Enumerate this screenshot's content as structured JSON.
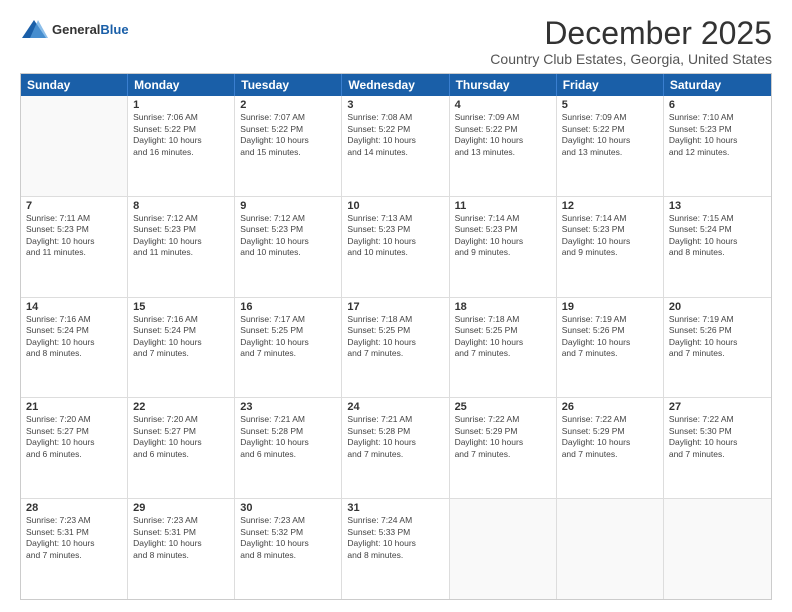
{
  "logo": {
    "general": "General",
    "blue": "Blue"
  },
  "title": "December 2025",
  "location": "Country Club Estates, Georgia, United States",
  "days_of_week": [
    "Sunday",
    "Monday",
    "Tuesday",
    "Wednesday",
    "Thursday",
    "Friday",
    "Saturday"
  ],
  "weeks": [
    [
      {
        "day": "",
        "info": ""
      },
      {
        "day": "1",
        "info": "Sunrise: 7:06 AM\nSunset: 5:22 PM\nDaylight: 10 hours\nand 16 minutes."
      },
      {
        "day": "2",
        "info": "Sunrise: 7:07 AM\nSunset: 5:22 PM\nDaylight: 10 hours\nand 15 minutes."
      },
      {
        "day": "3",
        "info": "Sunrise: 7:08 AM\nSunset: 5:22 PM\nDaylight: 10 hours\nand 14 minutes."
      },
      {
        "day": "4",
        "info": "Sunrise: 7:09 AM\nSunset: 5:22 PM\nDaylight: 10 hours\nand 13 minutes."
      },
      {
        "day": "5",
        "info": "Sunrise: 7:09 AM\nSunset: 5:22 PM\nDaylight: 10 hours\nand 13 minutes."
      },
      {
        "day": "6",
        "info": "Sunrise: 7:10 AM\nSunset: 5:23 PM\nDaylight: 10 hours\nand 12 minutes."
      }
    ],
    [
      {
        "day": "7",
        "info": "Sunrise: 7:11 AM\nSunset: 5:23 PM\nDaylight: 10 hours\nand 11 minutes."
      },
      {
        "day": "8",
        "info": "Sunrise: 7:12 AM\nSunset: 5:23 PM\nDaylight: 10 hours\nand 11 minutes."
      },
      {
        "day": "9",
        "info": "Sunrise: 7:12 AM\nSunset: 5:23 PM\nDaylight: 10 hours\nand 10 minutes."
      },
      {
        "day": "10",
        "info": "Sunrise: 7:13 AM\nSunset: 5:23 PM\nDaylight: 10 hours\nand 10 minutes."
      },
      {
        "day": "11",
        "info": "Sunrise: 7:14 AM\nSunset: 5:23 PM\nDaylight: 10 hours\nand 9 minutes."
      },
      {
        "day": "12",
        "info": "Sunrise: 7:14 AM\nSunset: 5:23 PM\nDaylight: 10 hours\nand 9 minutes."
      },
      {
        "day": "13",
        "info": "Sunrise: 7:15 AM\nSunset: 5:24 PM\nDaylight: 10 hours\nand 8 minutes."
      }
    ],
    [
      {
        "day": "14",
        "info": "Sunrise: 7:16 AM\nSunset: 5:24 PM\nDaylight: 10 hours\nand 8 minutes."
      },
      {
        "day": "15",
        "info": "Sunrise: 7:16 AM\nSunset: 5:24 PM\nDaylight: 10 hours\nand 7 minutes."
      },
      {
        "day": "16",
        "info": "Sunrise: 7:17 AM\nSunset: 5:25 PM\nDaylight: 10 hours\nand 7 minutes."
      },
      {
        "day": "17",
        "info": "Sunrise: 7:18 AM\nSunset: 5:25 PM\nDaylight: 10 hours\nand 7 minutes."
      },
      {
        "day": "18",
        "info": "Sunrise: 7:18 AM\nSunset: 5:25 PM\nDaylight: 10 hours\nand 7 minutes."
      },
      {
        "day": "19",
        "info": "Sunrise: 7:19 AM\nSunset: 5:26 PM\nDaylight: 10 hours\nand 7 minutes."
      },
      {
        "day": "20",
        "info": "Sunrise: 7:19 AM\nSunset: 5:26 PM\nDaylight: 10 hours\nand 7 minutes."
      }
    ],
    [
      {
        "day": "21",
        "info": "Sunrise: 7:20 AM\nSunset: 5:27 PM\nDaylight: 10 hours\nand 6 minutes."
      },
      {
        "day": "22",
        "info": "Sunrise: 7:20 AM\nSunset: 5:27 PM\nDaylight: 10 hours\nand 6 minutes."
      },
      {
        "day": "23",
        "info": "Sunrise: 7:21 AM\nSunset: 5:28 PM\nDaylight: 10 hours\nand 6 minutes."
      },
      {
        "day": "24",
        "info": "Sunrise: 7:21 AM\nSunset: 5:28 PM\nDaylight: 10 hours\nand 7 minutes."
      },
      {
        "day": "25",
        "info": "Sunrise: 7:22 AM\nSunset: 5:29 PM\nDaylight: 10 hours\nand 7 minutes."
      },
      {
        "day": "26",
        "info": "Sunrise: 7:22 AM\nSunset: 5:29 PM\nDaylight: 10 hours\nand 7 minutes."
      },
      {
        "day": "27",
        "info": "Sunrise: 7:22 AM\nSunset: 5:30 PM\nDaylight: 10 hours\nand 7 minutes."
      }
    ],
    [
      {
        "day": "28",
        "info": "Sunrise: 7:23 AM\nSunset: 5:31 PM\nDaylight: 10 hours\nand 7 minutes."
      },
      {
        "day": "29",
        "info": "Sunrise: 7:23 AM\nSunset: 5:31 PM\nDaylight: 10 hours\nand 8 minutes."
      },
      {
        "day": "30",
        "info": "Sunrise: 7:23 AM\nSunset: 5:32 PM\nDaylight: 10 hours\nand 8 minutes."
      },
      {
        "day": "31",
        "info": "Sunrise: 7:24 AM\nSunset: 5:33 PM\nDaylight: 10 hours\nand 8 minutes."
      },
      {
        "day": "",
        "info": ""
      },
      {
        "day": "",
        "info": ""
      },
      {
        "day": "",
        "info": ""
      }
    ]
  ]
}
